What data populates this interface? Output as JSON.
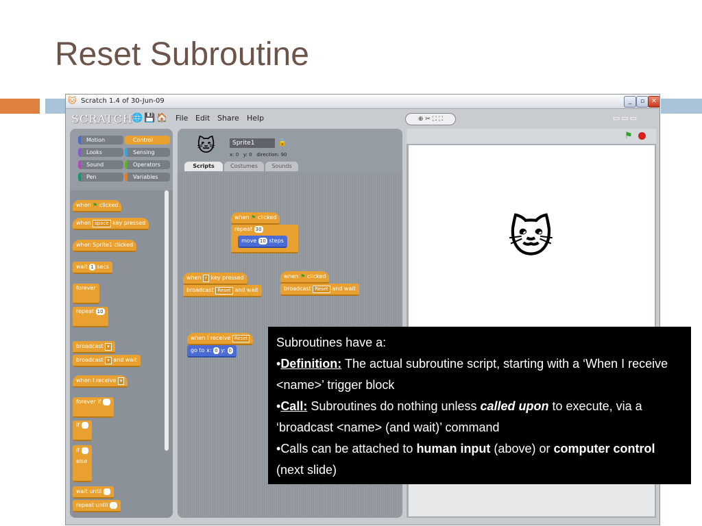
{
  "slide": {
    "title": "Reset Subroutine"
  },
  "window": {
    "title": "Scratch 1.4 of 30-Jun-09",
    "logo": "SCRATCH",
    "menu": [
      "File",
      "Edit",
      "Share",
      "Help"
    ],
    "controls": {
      "minimize": "_",
      "maximize": "▫",
      "close": "✕"
    }
  },
  "palette": {
    "categories": [
      "Motion",
      "Control",
      "Looks",
      "Sensing",
      "Sound",
      "Operators",
      "Pen",
      "Variables"
    ],
    "selected": "Control",
    "category_colors": [
      "#4a6cd4",
      "#e8a030",
      "#8a55d7",
      "#2ca5e2",
      "#bb42c3",
      "#5cb712",
      "#0e9a6c",
      "#ee7d16"
    ],
    "blocks": [
      {
        "pre": "when",
        "mid": "",
        "post": "clicked",
        "flag": true
      },
      {
        "pre": "when",
        "mid": "space",
        "post": "key pressed"
      },
      {
        "pre": "when Sprite1 clicked"
      },
      {
        "pre": "wait",
        "mid": "1",
        "post": "secs"
      },
      {
        "pre": "forever"
      },
      {
        "pre": "repeat",
        "mid": "10"
      },
      {
        "pre": "broadcast"
      },
      {
        "pre": "broadcast",
        "post": "and wait"
      },
      {
        "pre": "when I receive"
      },
      {
        "pre": "forever if"
      },
      {
        "pre": "if"
      },
      {
        "pre": "if"
      },
      {
        "pre": "else"
      },
      {
        "pre": "wait until"
      },
      {
        "pre": "repeat until"
      }
    ]
  },
  "sprite": {
    "name": "Sprite1",
    "x_label": "x:",
    "x": "0",
    "y_label": "y:",
    "y": "0",
    "dir_label": "direction:",
    "direction": "90"
  },
  "tabs": [
    "Scripts",
    "Costumes",
    "Sounds"
  ],
  "scripts": {
    "s1_hat_pre": "when",
    "s1_hat_post": "clicked",
    "s1_repeat": "repeat",
    "s1_repeat_val": "30",
    "s1_move": "move",
    "s1_move_val": "10",
    "s1_move_post": "steps",
    "s2_hat_pre": "when",
    "s2_hat_key": "r",
    "s2_hat_post": "key pressed",
    "s2_broadcast": "broadcast",
    "s2_msg": "Reset",
    "s2_post": "and wait",
    "s3_hat_pre": "when",
    "s3_hat_post": "clicked",
    "s3_broadcast": "broadcast",
    "s3_msg": "Reset",
    "s3_post": "and wait",
    "s4_hat": "when I receive",
    "s4_msg": "Reset",
    "s4_goto": "go to x:",
    "s4_x": "0",
    "s4_y_label": "y:",
    "s4_y": "0"
  },
  "callout": {
    "line1": "Subroutines have a:",
    "bullet": "•",
    "def_label": "Definition:",
    "def_text": " The actual subroutine script, starting with a ‘When I receive <name>’ trigger block",
    "call_label": "Call:",
    "call_text1": "  Subroutines do nothing unless ",
    "call_emph": "called upon",
    "call_text2": " to execute, via a ‘broadcast <name> (and wait)’ command",
    "attach_text1": "Calls can be attached to ",
    "attach_b1": "human input",
    "attach_text2": " (above) or ",
    "attach_b2": "computer control",
    "attach_text3": " (next slide)"
  }
}
